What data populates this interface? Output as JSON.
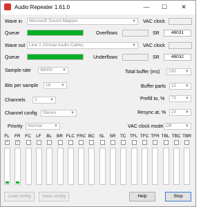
{
  "window": {
    "title": "Audio Repeater 1.61.0",
    "minimize": "—",
    "maximize": "☐",
    "close": "✕"
  },
  "wave_in": {
    "label": "Wave in",
    "device": "Microsoft Sound Mapper",
    "vac_clock_label": "VAC clock"
  },
  "queue_in": {
    "label": "Queue",
    "fill": 1.0,
    "overflows_label": "Overflows",
    "sr_label": "SR",
    "sr_value": "48031"
  },
  "wave_out": {
    "label": "Wave out",
    "device": "Line 1 (Virtual Audio Cable)",
    "vac_clock_label": "VAC clock"
  },
  "queue_out": {
    "label": "Queue",
    "fill": 1.0,
    "underflows_label": "Underflows",
    "sr_label": "SR",
    "sr_value": "48032"
  },
  "settings": {
    "sample_rate": {
      "label": "Sample rate",
      "value": "48000"
    },
    "bits_per_sample": {
      "label": "Bits per sample",
      "value": "16"
    },
    "channels": {
      "label": "Channels",
      "value": "2"
    },
    "channel_config": {
      "label": "Channel config",
      "value": "Stereo"
    },
    "priority": {
      "label": "Priority",
      "value": "Normal"
    },
    "total_buffer": {
      "label": "Total buffer (ms)",
      "value": "100"
    },
    "buffer_parts": {
      "label": "Buffer parts",
      "value": "12"
    },
    "prefill": {
      "label": "Prefill to, %",
      "value": "70"
    },
    "resync": {
      "label": "Resync at, %",
      "value": "20"
    },
    "vac_clock_mode": {
      "label": "VAC clock mode",
      "value": "Off"
    }
  },
  "channels": [
    {
      "name": "FL",
      "checked": true,
      "level": 0.05
    },
    {
      "name": "FR",
      "checked": true,
      "level": 0.05
    },
    {
      "name": "FC",
      "checked": false,
      "level": 0
    },
    {
      "name": "LF",
      "checked": false,
      "level": 0
    },
    {
      "name": "BL",
      "checked": false,
      "level": 0
    },
    {
      "name": "BR",
      "checked": false,
      "level": 0
    },
    {
      "name": "FLC",
      "checked": false,
      "level": 0
    },
    {
      "name": "FRC",
      "checked": false,
      "level": 0
    },
    {
      "name": "BC",
      "checked": false,
      "level": 0
    },
    {
      "name": "SL",
      "checked": false,
      "level": 0
    },
    {
      "name": "SR",
      "checked": false,
      "level": 0
    },
    {
      "name": "TC",
      "checked": false,
      "level": 0
    },
    {
      "name": "TFL",
      "checked": false,
      "level": 0
    },
    {
      "name": "TFC",
      "checked": false,
      "level": 0
    },
    {
      "name": "TFR",
      "checked": false,
      "level": 0
    },
    {
      "name": "TBL",
      "checked": false,
      "level": 0
    },
    {
      "name": "TBC",
      "checked": false,
      "level": 0
    },
    {
      "name": "TBR",
      "checked": false,
      "level": 0
    }
  ],
  "buttons": {
    "load_config": "Load config",
    "save_config": "Save config",
    "help": "Help",
    "stop": "Stop"
  },
  "colors": {
    "queue_green": "#06b025",
    "accent_blue": "#3a7fd5"
  }
}
